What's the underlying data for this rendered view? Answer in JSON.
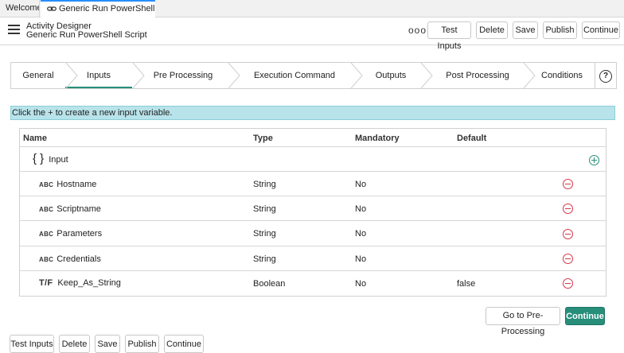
{
  "tabs": [
    {
      "label": "Welcome"
    },
    {
      "label": "Generic Run PowerShell Sc..."
    }
  ],
  "header": {
    "title": "Activity Designer",
    "subtitle": "Generic Run PowerShell Script",
    "more_label": "ooo",
    "buttons": {
      "test_inputs": "Test Inputs",
      "delete": "Delete",
      "save": "Save",
      "publish": "Publish",
      "continue": "Continue"
    }
  },
  "steps": [
    {
      "label": "General"
    },
    {
      "label": "Inputs",
      "active": true
    },
    {
      "label": "Pre Processing"
    },
    {
      "label": "Execution Command"
    },
    {
      "label": "Outputs"
    },
    {
      "label": "Post Processing"
    },
    {
      "label": "Conditions"
    }
  ],
  "help_label": "?",
  "info_message": "Click the + to create a new input variable.",
  "table": {
    "columns": [
      "Name",
      "Type",
      "Mandatory",
      "Default"
    ],
    "group": {
      "icon": "{ }",
      "label": "Input"
    },
    "rows": [
      {
        "type_badge": "ABC",
        "name": "Hostname",
        "type": "String",
        "mandatory": "No",
        "default": ""
      },
      {
        "type_badge": "ABC",
        "name": "Scriptname",
        "type": "String",
        "mandatory": "No",
        "default": ""
      },
      {
        "type_badge": "ABC",
        "name": "Parameters",
        "type": "String",
        "mandatory": "No",
        "default": ""
      },
      {
        "type_badge": "ABC",
        "name": "Credentials",
        "type": "String",
        "mandatory": "No",
        "default": ""
      },
      {
        "type_badge": "T/F",
        "name": "Keep_As_String",
        "type": "Boolean",
        "mandatory": "No",
        "default": "false"
      }
    ]
  },
  "nav": {
    "go_to_pre": "Go to Pre-Processing",
    "continue": "Continue"
  },
  "footer": {
    "test_inputs": "Test Inputs",
    "delete": "Delete",
    "save": "Save",
    "publish": "Publish",
    "continue": "Continue"
  },
  "colors": {
    "accent": "#278e7a",
    "remove": "#d2384a",
    "info_bg": "#b8e3ea",
    "tab_active": "#278efc"
  }
}
